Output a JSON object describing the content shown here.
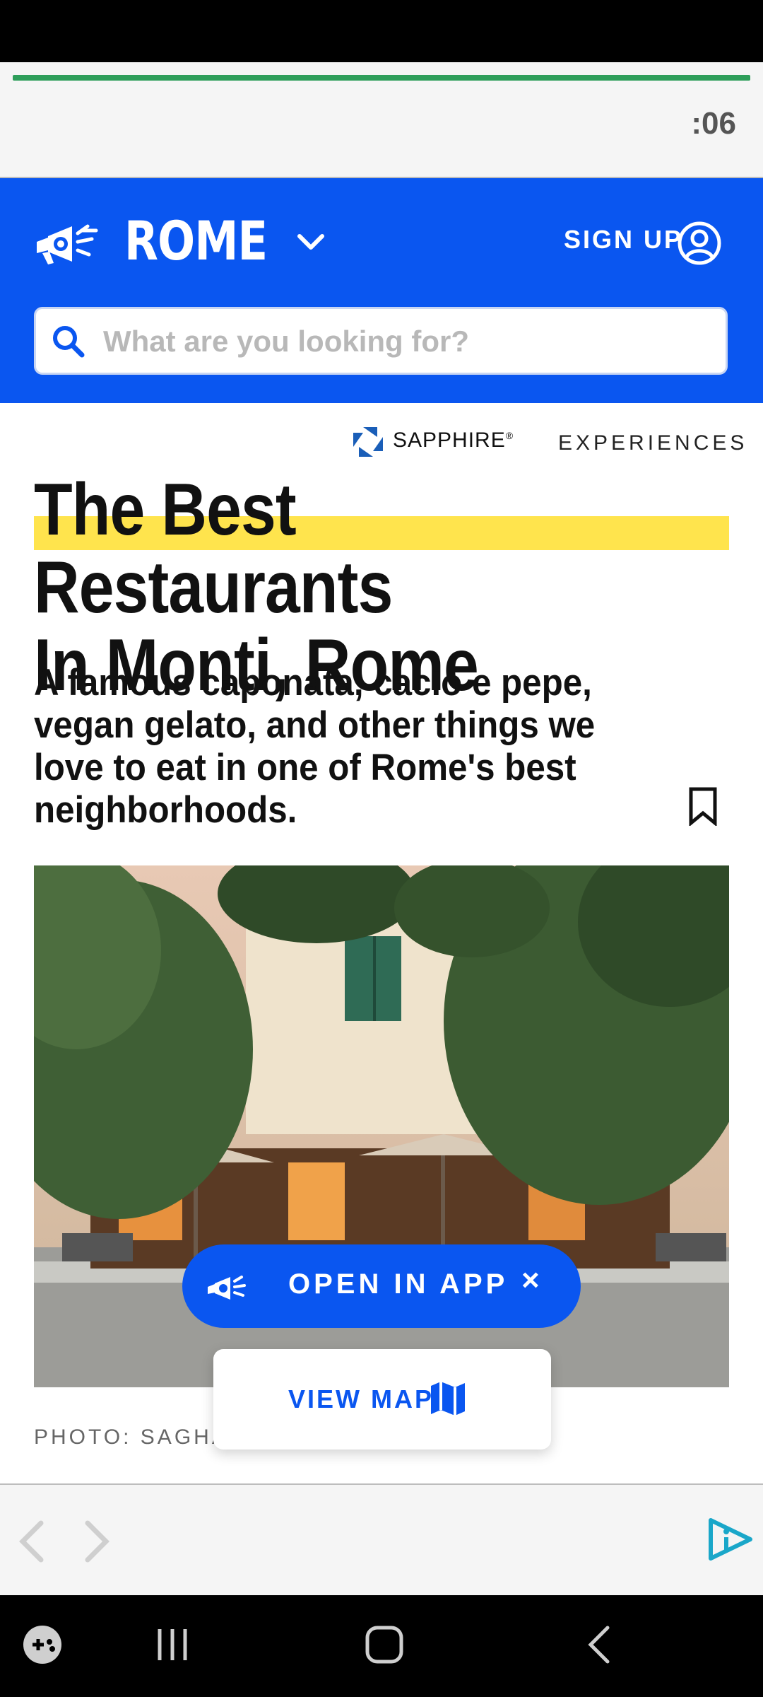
{
  "ad_top": {
    "timer": ":06",
    "progress_color": "#2e9e5a"
  },
  "header": {
    "city": "ROME",
    "signup_label": "SIGN UP",
    "brand_color": "#0a56f0"
  },
  "search": {
    "placeholder": "What are you looking for?"
  },
  "sponsor": {
    "name": "SAPPHIRE",
    "mark": "®",
    "tag": "EXPERIENCES"
  },
  "article": {
    "headline_line1": "The Best Restaurants",
    "headline_line2": "In Monti, Rome",
    "subheadline": "A famous caponata, cacio e pepe, vegan gelato, and other things we love to eat in one of Rome's best neighborhoods.",
    "photo_credit": "PHOTO: SAGHA",
    "highlight_color": "#ffe44d"
  },
  "open_app": {
    "label": "OPEN IN APP",
    "close": "×"
  },
  "view_map": {
    "label": "VIEW MAP"
  },
  "icons": {
    "logo": "megaphone-icon",
    "chevron": "chevron-down-icon",
    "account": "account-icon",
    "search": "search-icon",
    "bookmark": "bookmark-icon",
    "map": "map-icon",
    "ad_info": "ad-choices-icon"
  }
}
